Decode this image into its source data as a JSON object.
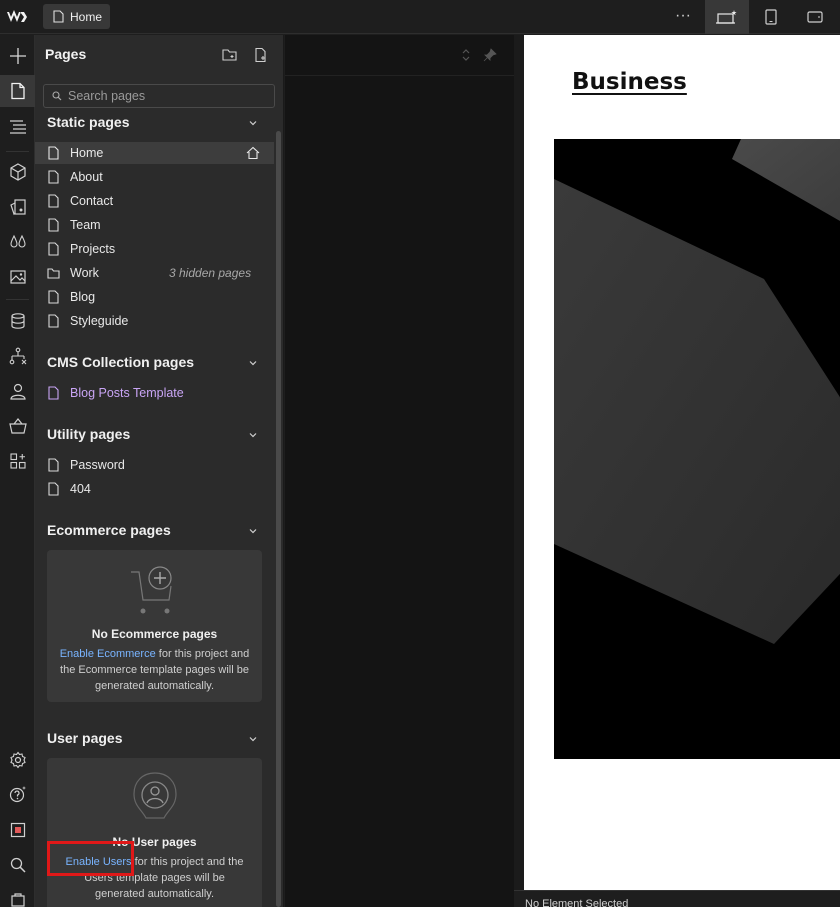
{
  "topbar": {
    "page_tab_label": "Home",
    "more_label": "···"
  },
  "panel": {
    "title": "Pages",
    "search_placeholder": "Search pages",
    "sections": {
      "static": {
        "title": "Static pages",
        "pages": [
          {
            "name": "Home"
          },
          {
            "name": "About"
          },
          {
            "name": "Contact"
          },
          {
            "name": "Team"
          },
          {
            "name": "Projects"
          },
          {
            "name": "Work",
            "note": "3 hidden pages"
          },
          {
            "name": "Blog"
          },
          {
            "name": "Styleguide"
          }
        ]
      },
      "cms": {
        "title": "CMS Collection pages",
        "pages": [
          {
            "name": "Blog Posts Template"
          }
        ]
      },
      "utility": {
        "title": "Utility pages",
        "pages": [
          {
            "name": "Password"
          },
          {
            "name": "404"
          }
        ]
      },
      "ecommerce": {
        "title": "Ecommerce pages",
        "empty_title": "No Ecommerce pages",
        "link_text": "Enable Ecommerce",
        "desc_line1_rest": " for this project and",
        "desc_line2": "the Ecommerce template pages will be",
        "desc_line3": "generated automatically."
      },
      "user": {
        "title": "User pages",
        "empty_title": "No User pages",
        "link_text": "Enable Users",
        "desc_line1_rest": " for this project and the",
        "desc_line2": "Users template pages will be",
        "desc_line3": "generated automatically."
      }
    }
  },
  "canvas": {
    "heading": "Business"
  },
  "status_bar": {
    "text": "No Element Selected"
  },
  "colors": {
    "accent_link": "#79b4ff",
    "cms_page": "#c9a5f5",
    "highlight": "#e01818"
  }
}
